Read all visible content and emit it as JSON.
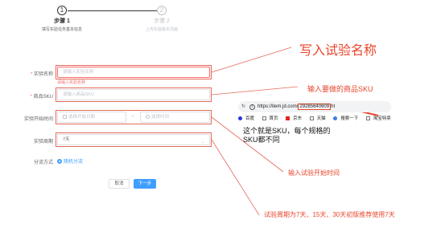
{
  "steps": [
    {
      "num": "1",
      "title": "步骤 1",
      "desc": "填写实验任务基本信息"
    },
    {
      "num": "2",
      "title": "步骤 2",
      "desc": "上传实验版本页面"
    }
  ],
  "form": {
    "name": {
      "label": "实验名称",
      "placeholder": "请输入实验名称",
      "error": "请输入实验名称"
    },
    "sku": {
      "label": "商品SKU",
      "placeholder": "请输入商品SKU"
    },
    "start": {
      "label": "实验开始时间",
      "date_placeholder": "选择开始日期",
      "separator": "-",
      "time_placeholder": "选择时间"
    },
    "period": {
      "label": "实验周期",
      "value": "7天"
    },
    "split": {
      "label": "分流方式",
      "option": "随机分流"
    }
  },
  "buttons": {
    "cancel": "取消",
    "next": "下一步"
  },
  "annotations": {
    "name": "写入试验名称",
    "sku": "输入要做的商品SKU",
    "start": "输入试验开始时间",
    "period": "试验周期为7天、15天、30天初版推荐使用7天"
  },
  "browser": {
    "url_prefix": "https://item.jd.com/",
    "sku": "29285640609",
    "url_suffix": "ht",
    "bookmarks": [
      "百度",
      "首页",
      "京东",
      "天猫",
      "搜索一下",
      "淘宝特卖"
    ]
  },
  "note": "这个就是SKU，每个规格的SKU都不同",
  "colors": {
    "accent": "#409eff",
    "annotation": "#e8452c",
    "error": "#f56c6c"
  }
}
